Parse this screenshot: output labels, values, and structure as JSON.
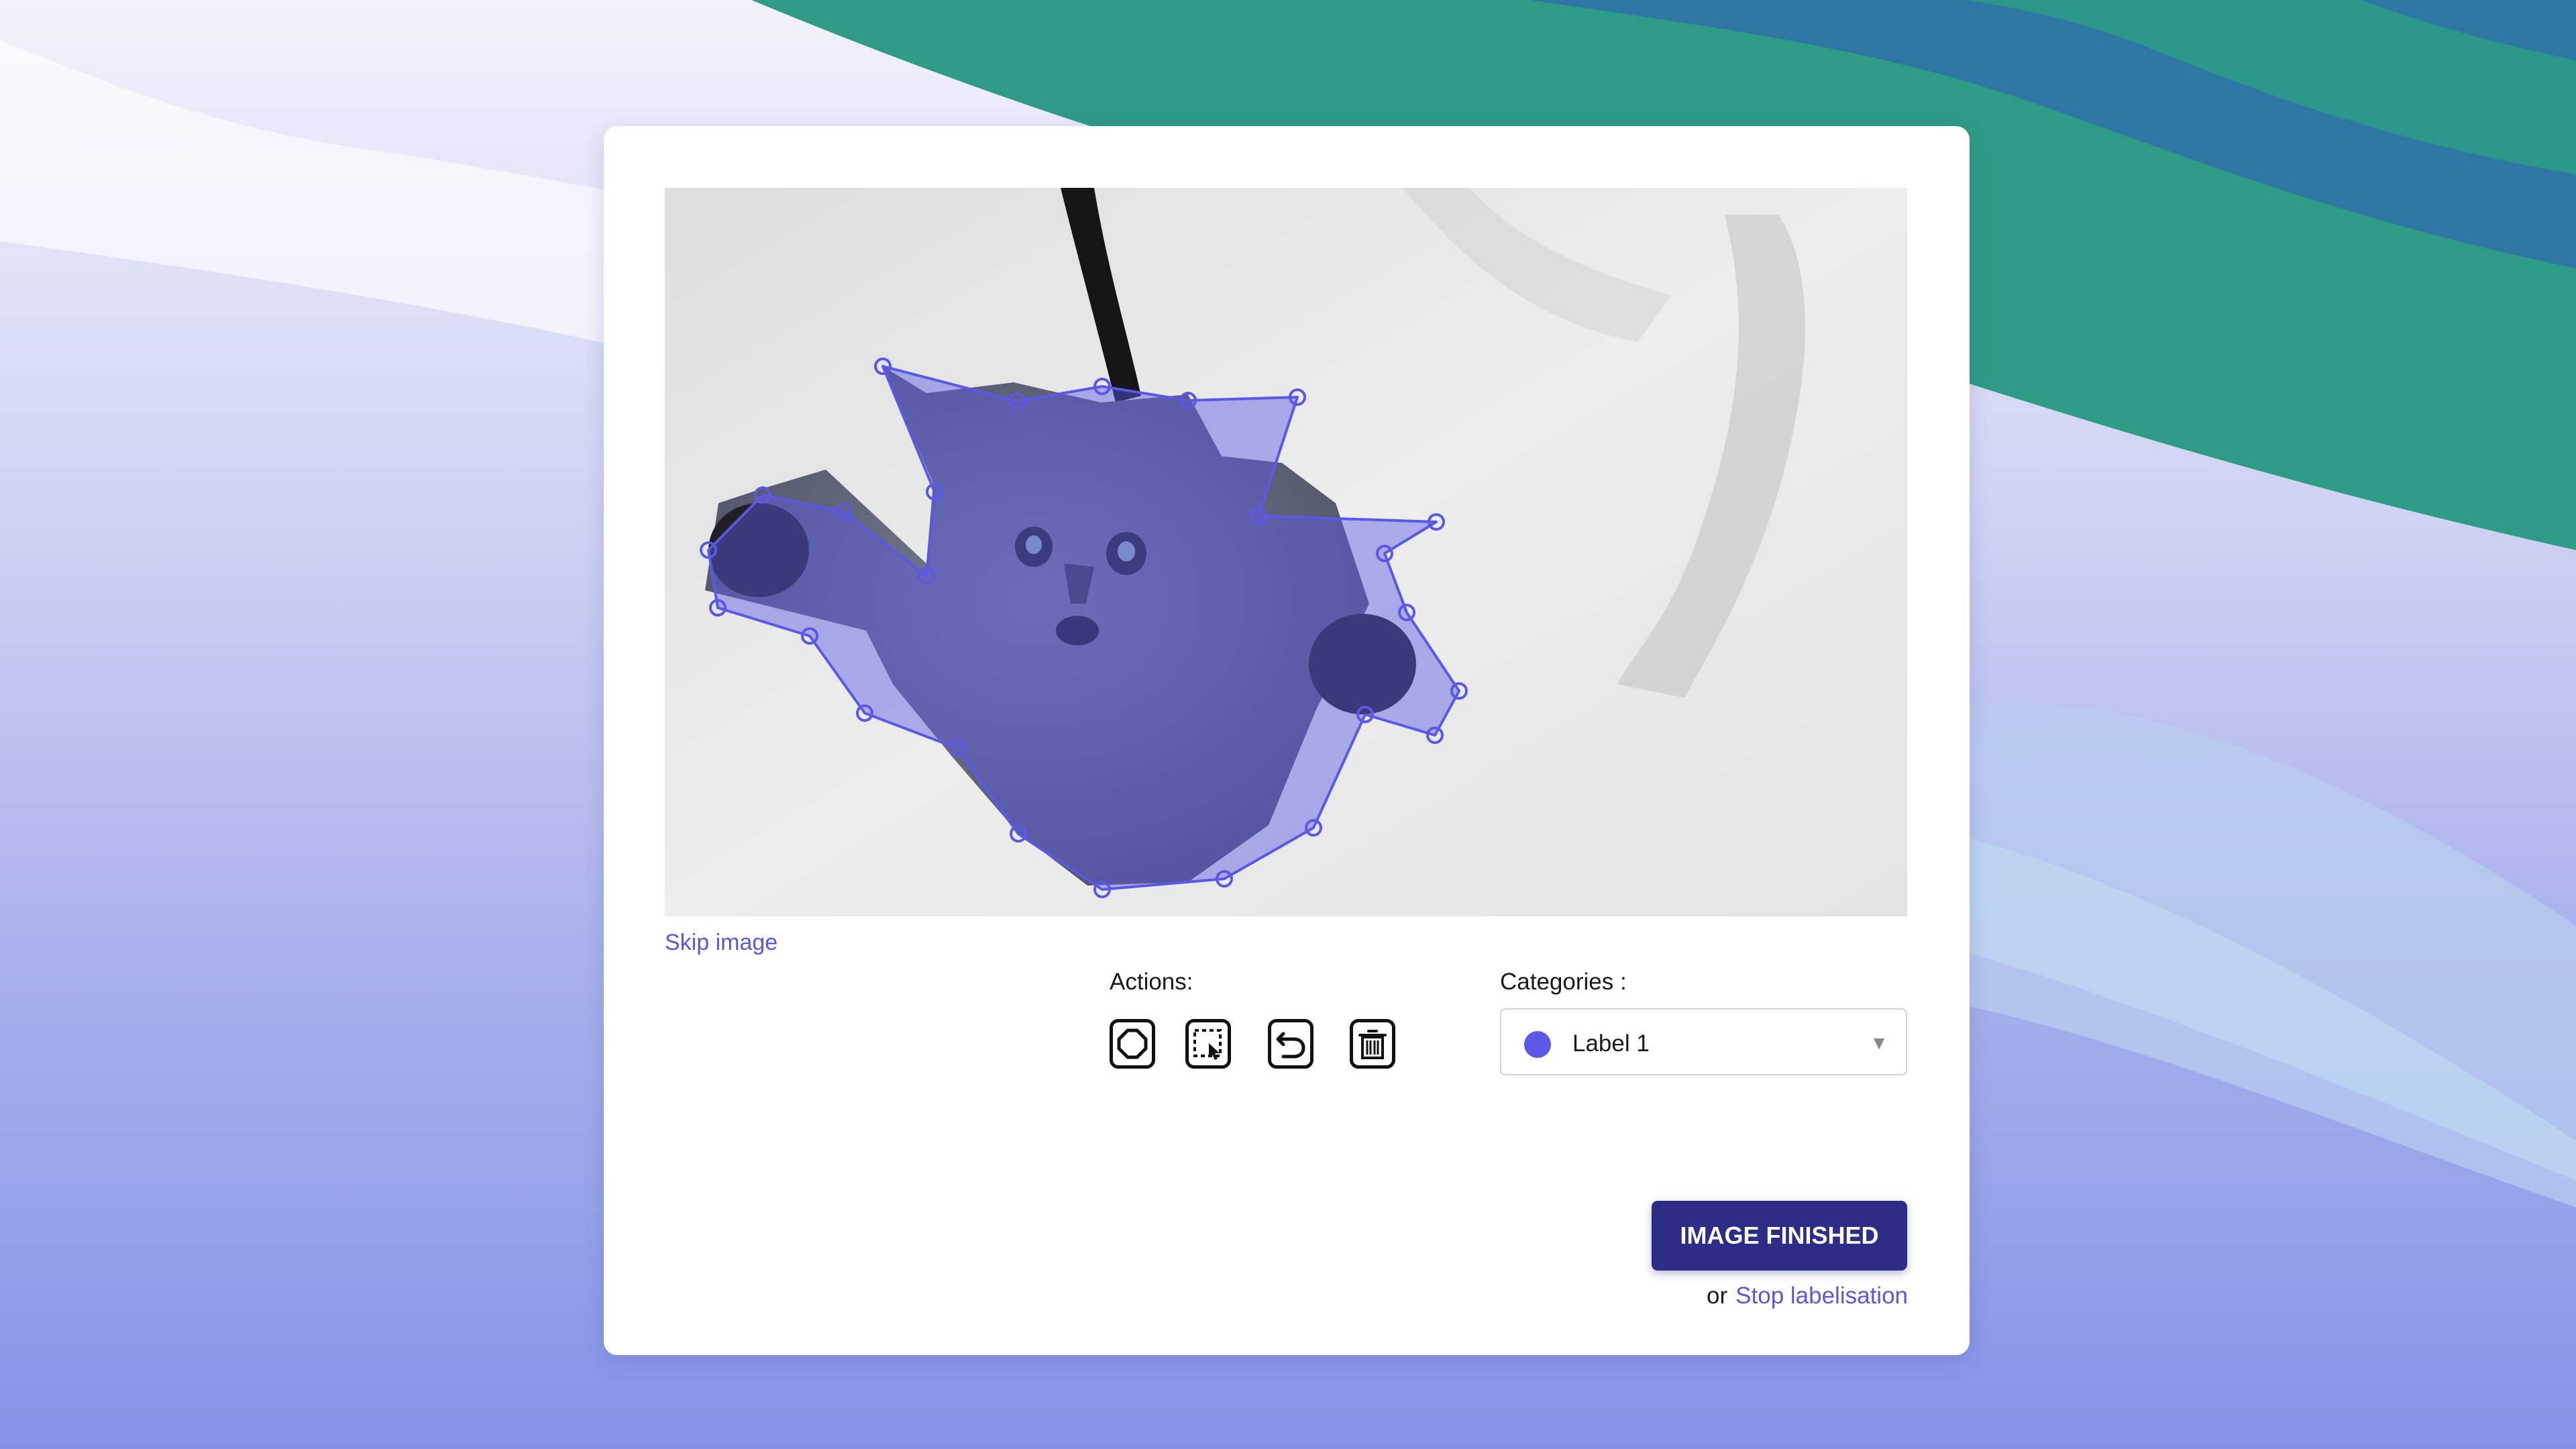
{
  "colors": {
    "accent": "#5a58d8",
    "label_color": "#5b58e6",
    "button_bg": "#2d2c86",
    "bg_green": "#2e9b86",
    "bg_teal": "#2d78a2"
  },
  "annotator": {
    "skip_label": "Skip image",
    "actions_label": "Actions:",
    "tools": [
      {
        "icon": "polygon-icon"
      },
      {
        "icon": "select-icon"
      },
      {
        "icon": "undo-icon"
      },
      {
        "icon": "trash-icon"
      }
    ],
    "categories_label": "Categories :",
    "category": {
      "selected": "Label 1"
    },
    "finish_label": "IMAGE FINISHED",
    "or_label": "or",
    "stop_label": "Stop labelisation"
  }
}
